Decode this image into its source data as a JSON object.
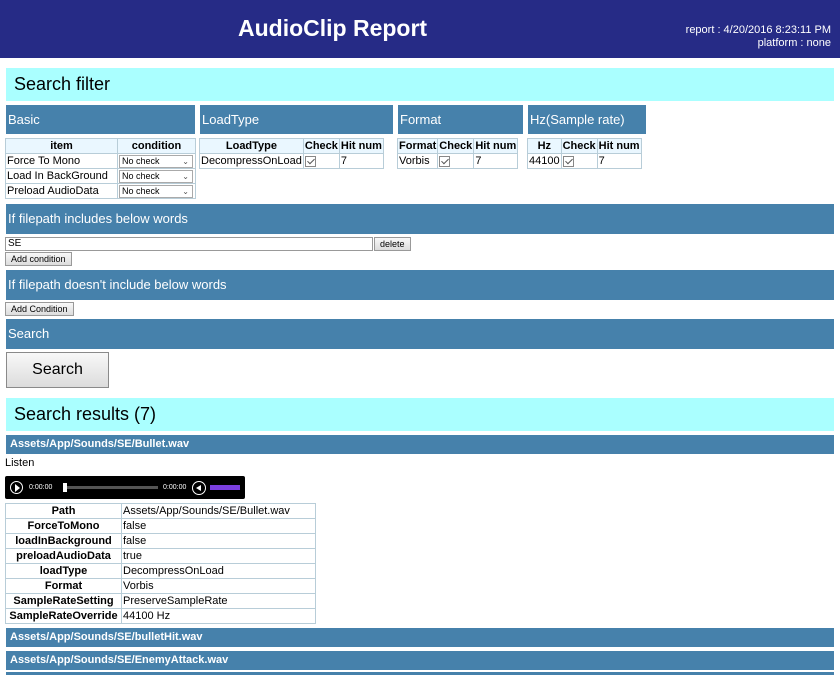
{
  "header": {
    "title": "AudioClip Report",
    "report": "report : 4/20/2016 8:23:11 PM",
    "platform": "platform : none"
  },
  "filter": {
    "title": "Search filter",
    "basic": {
      "title": "Basic",
      "col_item": "item",
      "col_condition": "condition",
      "rows": [
        {
          "item": "Force To Mono",
          "condition": "No check"
        },
        {
          "item": "Load In BackGround",
          "condition": "No check"
        },
        {
          "item": "Preload AudioData",
          "condition": "No check"
        }
      ]
    },
    "loadtype": {
      "title": "LoadType",
      "col_type": "LoadType",
      "col_check": "Check",
      "col_hit": "Hit num",
      "value": "DecompressOnLoad",
      "hit": "7"
    },
    "format": {
      "title": "Format",
      "col_type": "Format",
      "col_check": "Check",
      "col_hit": "Hit num",
      "value": "Vorbis",
      "hit": "7"
    },
    "hz": {
      "title": "Hz(Sample rate)",
      "col_type": "Hz",
      "col_check": "Check",
      "col_hit": "Hit num",
      "value": "44100",
      "hit": "7"
    },
    "include": {
      "title": "If filepath includes below words",
      "value": "SE",
      "delete_label": "delete",
      "add_label": "Add condition"
    },
    "exclude": {
      "title": "If filepath doesn't include below words",
      "add_label": "Add Condition"
    },
    "search": {
      "title": "Search",
      "button_label": "Search"
    }
  },
  "results": {
    "title": "Search results (7)",
    "items": [
      {
        "path": "Assets/App/Sounds/SE/Bullet.wav",
        "listen_label": "Listen",
        "player": {
          "current": "0:00:00",
          "duration": "0:00:00"
        },
        "props": [
          {
            "key": "Path",
            "value": "Assets/App/Sounds/SE/Bullet.wav"
          },
          {
            "key": "ForceToMono",
            "value": "false"
          },
          {
            "key": "loadInBackground",
            "value": "false"
          },
          {
            "key": "preloadAudioData",
            "value": "true"
          },
          {
            "key": "loadType",
            "value": "DecompressOnLoad"
          },
          {
            "key": "Format",
            "value": "Vorbis"
          },
          {
            "key": "SampleRateSetting",
            "value": "PreserveSampleRate"
          },
          {
            "key": "SampleRateOverride",
            "value": "44100 Hz"
          }
        ]
      },
      {
        "path": "Assets/App/Sounds/SE/bulletHit.wav"
      },
      {
        "path": "Assets/App/Sounds/SE/EnemyAttack.wav"
      }
    ]
  }
}
